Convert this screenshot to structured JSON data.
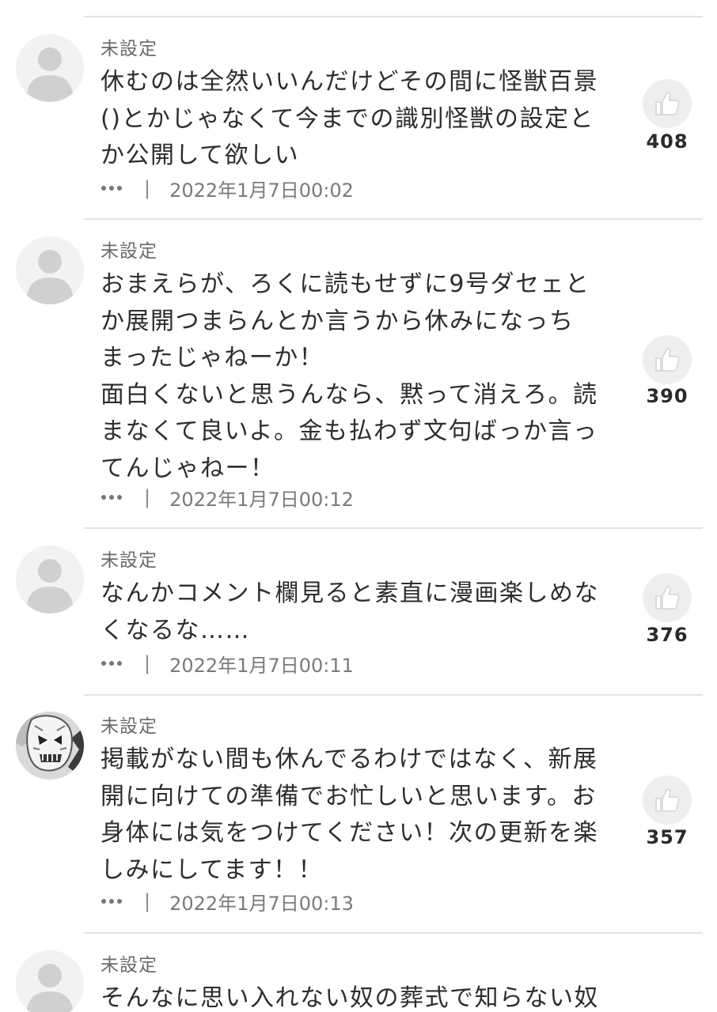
{
  "comments": [
    {
      "username": "未設定",
      "text": "休むのは全然いいんだけどその間に怪獣百景\n()とかじゃなくて今までの識別怪獣の設定と\nか公開して欲しい",
      "timestamp": "2022年1月7日00:02",
      "likes": "408",
      "avatar": "default-user-icon"
    },
    {
      "username": "未設定",
      "text": "おまえらが、ろくに読もせずに9号ダセェと\nか展開つまらんとか言うから休みになっち\nまったじゃねーか！\n面白くないと思うんなら、黙って消えろ。読\nまなくて良いよ。金も払わず文句ばっか言っ\nてんじゃねー！",
      "timestamp": "2022年1月7日00:12",
      "likes": "390",
      "avatar": "default-user-icon"
    },
    {
      "username": "未設定",
      "text": "なんかコメント欄見ると素直に漫画楽しめな\nくなるな……",
      "timestamp": "2022年1月7日00:11",
      "likes": "376",
      "avatar": "default-user-icon"
    },
    {
      "username": "未設定",
      "text": "掲載がない間も休んでるわけではなく、新展\n開に向けての準備でお忙しいと思います。お\n身体には気をつけてください！次の更新を楽\nしみにしてます！！",
      "timestamp": "2022年1月7日00:13",
      "likes": "357",
      "avatar": "monster-face-picture"
    },
    {
      "username": "未設定",
      "text": "そんなに思い入れない奴の葬式で知らない奴",
      "avatar": "default-user-icon"
    }
  ]
}
